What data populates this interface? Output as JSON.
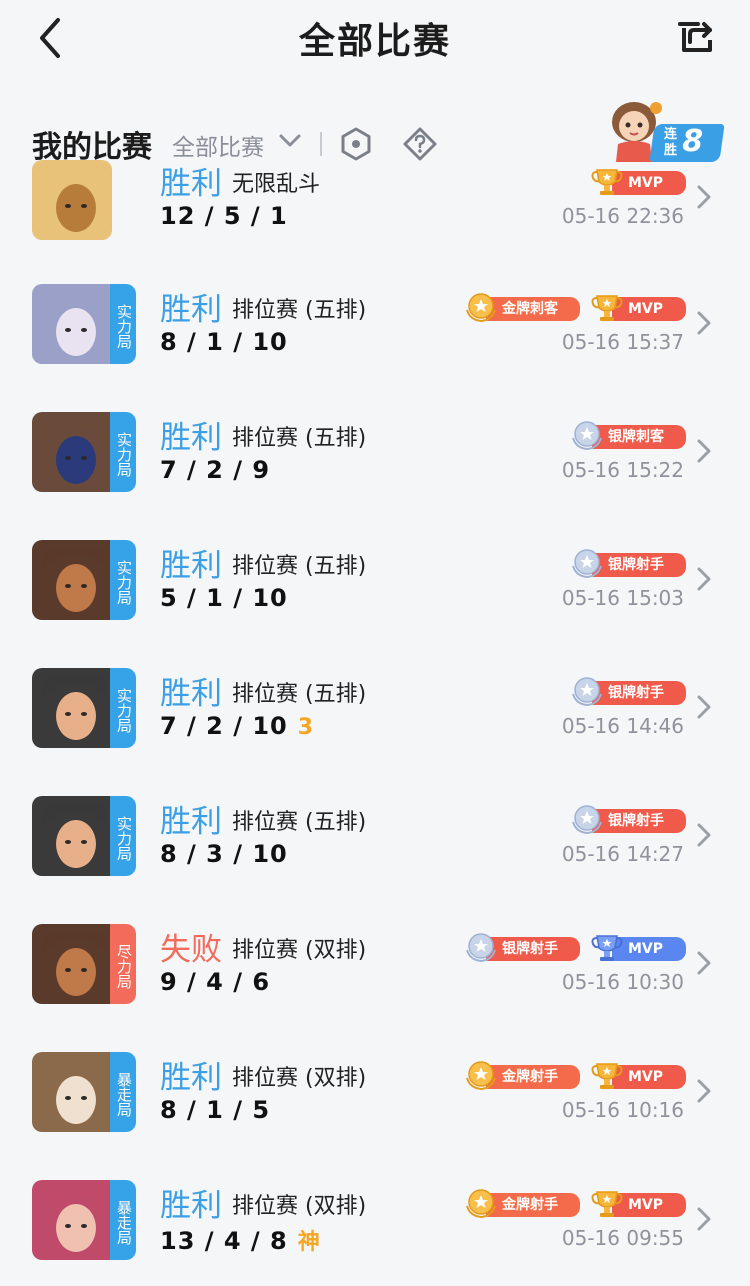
{
  "header": {
    "title": "全部比赛",
    "back_icon": "back-arrow-icon",
    "share_icon": "share-icon"
  },
  "section": {
    "title": "我的比赛",
    "filter_label": "全部比赛",
    "streak_label_1": "连",
    "streak_label_2": "胜",
    "streak_count": "8"
  },
  "matches": [
    {
      "result": "胜利",
      "mode": "无限乱斗",
      "kda": "12 / 5 / 1",
      "extra": "",
      "time": "05-16 22:36",
      "tag": "",
      "badges": [
        {
          "text": "MVP",
          "type": "mvp-gold"
        }
      ]
    },
    {
      "result": "胜利",
      "mode": "排位赛 (五排)",
      "kda": "8 / 1 / 10",
      "extra": "",
      "time": "05-16 15:37",
      "tag": "实力局",
      "badges": [
        {
          "text": "金牌刺客",
          "type": "gold"
        },
        {
          "text": "MVP",
          "type": "mvp-gold"
        }
      ]
    },
    {
      "result": "胜利",
      "mode": "排位赛 (五排)",
      "kda": "7 / 2 / 9",
      "extra": "",
      "time": "05-16 15:22",
      "tag": "实力局",
      "badges": [
        {
          "text": "银牌刺客",
          "type": "silver"
        }
      ]
    },
    {
      "result": "胜利",
      "mode": "排位赛 (五排)",
      "kda": "5 / 1 / 10",
      "extra": "",
      "time": "05-16 15:03",
      "tag": "实力局",
      "badges": [
        {
          "text": "银牌射手",
          "type": "silver"
        }
      ]
    },
    {
      "result": "胜利",
      "mode": "排位赛 (五排)",
      "kda": "7 / 2 / 10",
      "extra": "3",
      "time": "05-16 14:46",
      "tag": "实力局",
      "badges": [
        {
          "text": "银牌射手",
          "type": "silver"
        }
      ]
    },
    {
      "result": "胜利",
      "mode": "排位赛 (五排)",
      "kda": "8 / 3 / 10",
      "extra": "",
      "time": "05-16 14:27",
      "tag": "实力局",
      "badges": [
        {
          "text": "银牌射手",
          "type": "silver"
        }
      ]
    },
    {
      "result": "失败",
      "mode": "排位赛 (双排)",
      "kda": "9 / 4 / 6",
      "extra": "",
      "time": "05-16 10:30",
      "tag": "尽力局",
      "badges": [
        {
          "text": "银牌射手",
          "type": "silver"
        },
        {
          "text": "MVP",
          "type": "mvp-blue"
        }
      ]
    },
    {
      "result": "胜利",
      "mode": "排位赛 (双排)",
      "kda": "8 / 1 / 5",
      "extra": "",
      "time": "05-16 10:16",
      "tag": "暴走局",
      "badges": [
        {
          "text": "金牌射手",
          "type": "gold"
        },
        {
          "text": "MVP",
          "type": "mvp-gold"
        }
      ]
    },
    {
      "result": "胜利",
      "mode": "排位赛 (双排)",
      "kda": "13 / 4 / 8",
      "extra": "神",
      "time": "05-16 09:55",
      "tag": "暴走局",
      "badges": [
        {
          "text": "金牌射手",
          "type": "gold"
        },
        {
          "text": "MVP",
          "type": "mvp-gold"
        }
      ]
    }
  ],
  "colors": {
    "win": "#3b9fe6",
    "lose": "#f26b5b",
    "tag_blue": "#36a2e8",
    "tag_red": "#f26b5b",
    "badge_red": "#f05a4a",
    "badge_blue": "#5a86f0",
    "gold": "#f5a623"
  }
}
